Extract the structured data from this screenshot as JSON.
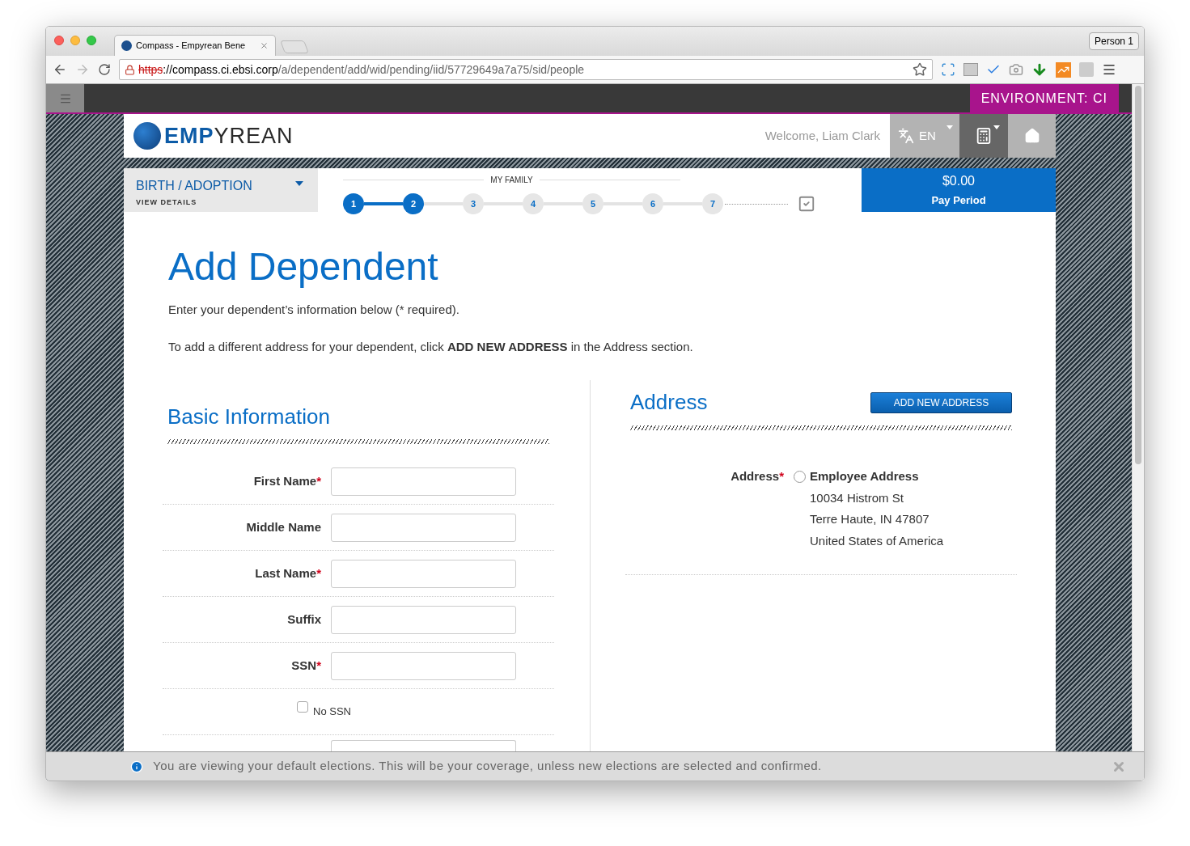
{
  "browser": {
    "tab_title": "Compass - Empyrean Bene",
    "profile": "Person 1",
    "url_scheme": "https",
    "url_host": "://compass.ci.ebsi.corp",
    "url_path": "/a/dependent/add/wid/pending/iid/57729649a7a75/sid/people"
  },
  "topbar": {
    "environment": "ENVIRONMENT: CI"
  },
  "header": {
    "logo_strong": "EMP",
    "logo_rest": "YREAN",
    "welcome": "Welcome, Liam Clark",
    "language": "EN"
  },
  "life_event": {
    "title": "BIRTH / ADOPTION",
    "link": "VIEW DETAILS"
  },
  "stepper": {
    "section": "MY FAMILY",
    "steps": [
      {
        "label": "1",
        "done": true
      },
      {
        "label": "2",
        "done": true
      },
      {
        "label": "3",
        "done": false
      },
      {
        "label": "4",
        "done": false
      },
      {
        "label": "5",
        "done": false
      },
      {
        "label": "6",
        "done": false
      },
      {
        "label": "7",
        "done": false
      }
    ]
  },
  "cost": {
    "amount": "$0.00",
    "period": "Pay Period"
  },
  "page": {
    "title": "Add Dependent",
    "intro": [
      "Enter your dependent’s information below (* required).",
      "To add a different address for your dependent, click **ADD NEW ADDRESS** in the Address section."
    ]
  },
  "basic_info": {
    "heading": "Basic Information",
    "required_mark": "*",
    "fields": [
      {
        "label": "First Name",
        "required": true
      },
      {
        "label": "Middle Name",
        "required": false
      },
      {
        "label": "Last Name",
        "required": true
      },
      {
        "label": "Suffix",
        "required": false
      },
      {
        "label": "SSN",
        "required": true
      }
    ],
    "checkbox": {
      "label": "No SSN",
      "checked": false
    }
  },
  "address": {
    "heading": "Address",
    "button": "ADD NEW ADDRESS",
    "label": "Address",
    "required": true,
    "required_mark": "*",
    "option": {
      "title": "Employee Address",
      "selected": false,
      "lines": [
        "10034 Histrom St",
        "Terre Haute, IN 47807",
        "United States of America"
      ]
    }
  },
  "notice": {
    "text": "You are viewing your default elections. This will be your coverage, unless new elections are selected and confirmed."
  }
}
